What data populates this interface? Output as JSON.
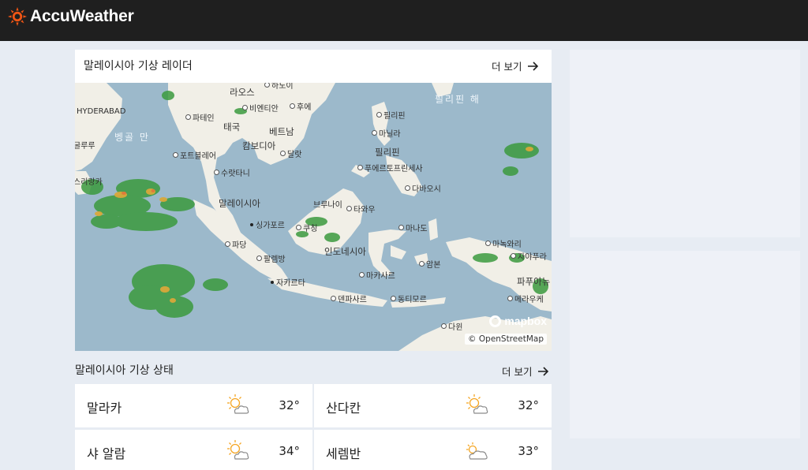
{
  "header": {
    "brand": "AccuWeather"
  },
  "radar": {
    "title": "말레이시아 기상 레이더",
    "more_label": "더 보기",
    "labels": {
      "hyderabad": "HYDERABAD",
      "bay_of_bengal": "벵골 만",
      "laos": "라오스",
      "vientiane": "비엔티안",
      "hanoi_top": "하노이",
      "hue": "후에",
      "taipei": "파테인",
      "thailand": "태국",
      "vietnam": "베트남",
      "cambodia": "캄보디아",
      "dalat": "달랏",
      "port_blair": "포트블레어",
      "surat": "수랏타니",
      "srilanka": "스리랑카",
      "gulu": "굴루루",
      "malaysia": "말레이시아",
      "singapore": "싱가포르",
      "padang": "파당",
      "palembang": "팔렘방",
      "jakarta": "자카르타",
      "kuching": "쿠칭",
      "brunei": "브루나이",
      "tawau": "타와우",
      "indonesia": "인도네시아",
      "makassar": "마카사르",
      "manado": "마나도",
      "ambon": "암본",
      "denpasar": "덴파사르",
      "dili": "동티모르",
      "darwin": "다윈",
      "philippines_sea": "필리핀 해",
      "legazpi": "필리핀",
      "manila": "마닐라",
      "luzon": "필리핀",
      "puerto": "푸에르토프린세사",
      "davao": "다바오시",
      "manokwari": "마녹와리",
      "jayapura": "자야푸라",
      "papua": "파푸아뉴",
      "merauke": "메라우케"
    },
    "mapbox_label": "mapbox",
    "attribution": "© OpenStreetMap"
  },
  "conditions": {
    "title": "말레이시아 기상 상태",
    "more_label": "더 보기",
    "cities": [
      {
        "name": "말라카",
        "temp": "32°",
        "icon": "partly-sunny-icon"
      },
      {
        "name": "산다칸",
        "temp": "32°",
        "icon": "partly-sunny-icon"
      },
      {
        "name": "샤 알람",
        "temp": "34°",
        "icon": "partly-sunny-icon"
      },
      {
        "name": "세렘반",
        "temp": "33°",
        "icon": "mostly-cloudy-icon"
      }
    ]
  },
  "colors": {
    "accent": "#f05514",
    "header_bg": "#1f1f1f",
    "page_bg": "#e7ecf3",
    "sea": "#9cb9cb",
    "land": "#f1efe7"
  }
}
